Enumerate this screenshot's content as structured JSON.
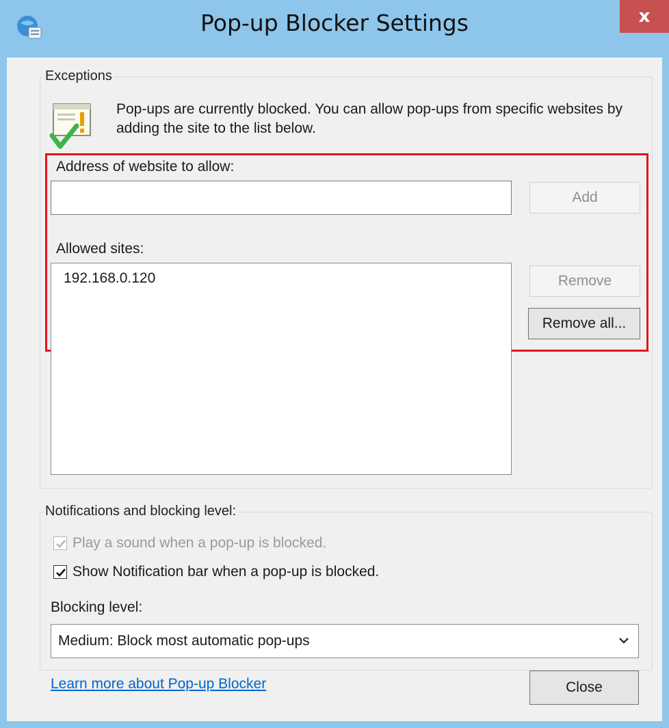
{
  "window": {
    "title": "Pop-up Blocker Settings",
    "close_glyph": "x"
  },
  "exceptions": {
    "group_label": "Exceptions",
    "info_text": "Pop-ups are currently blocked.  You can allow pop-ups from specific websites by adding the site to the list below.",
    "address_label": "Address of website to allow:",
    "address_value": "",
    "add_button": "Add",
    "allowed_label": "Allowed sites:",
    "allowed_sites": [
      "192.168.0.120"
    ],
    "remove_button": "Remove",
    "remove_all_button": "Remove all..."
  },
  "notifications": {
    "group_label": "Notifications and blocking level:",
    "play_sound_label": "Play a sound when a pop-up is blocked.",
    "play_sound_checked": true,
    "play_sound_enabled": false,
    "show_bar_label": "Show Notification bar when a pop-up is blocked.",
    "show_bar_checked": true,
    "blocking_level_label": "Blocking level:",
    "blocking_level_value": "Medium: Block most automatic pop-ups"
  },
  "footer": {
    "learn_more_link": "Learn more about Pop-up Blocker",
    "close_button": "Close"
  },
  "colors": {
    "titlebar": "#8ec5ea",
    "close_button": "#c75050",
    "highlight": "#e0141e",
    "link": "#0066cc"
  },
  "icons": {
    "app": "internet-options-icon",
    "info": "popup-blocked-icon",
    "dropdown": "chevron-down-icon"
  }
}
